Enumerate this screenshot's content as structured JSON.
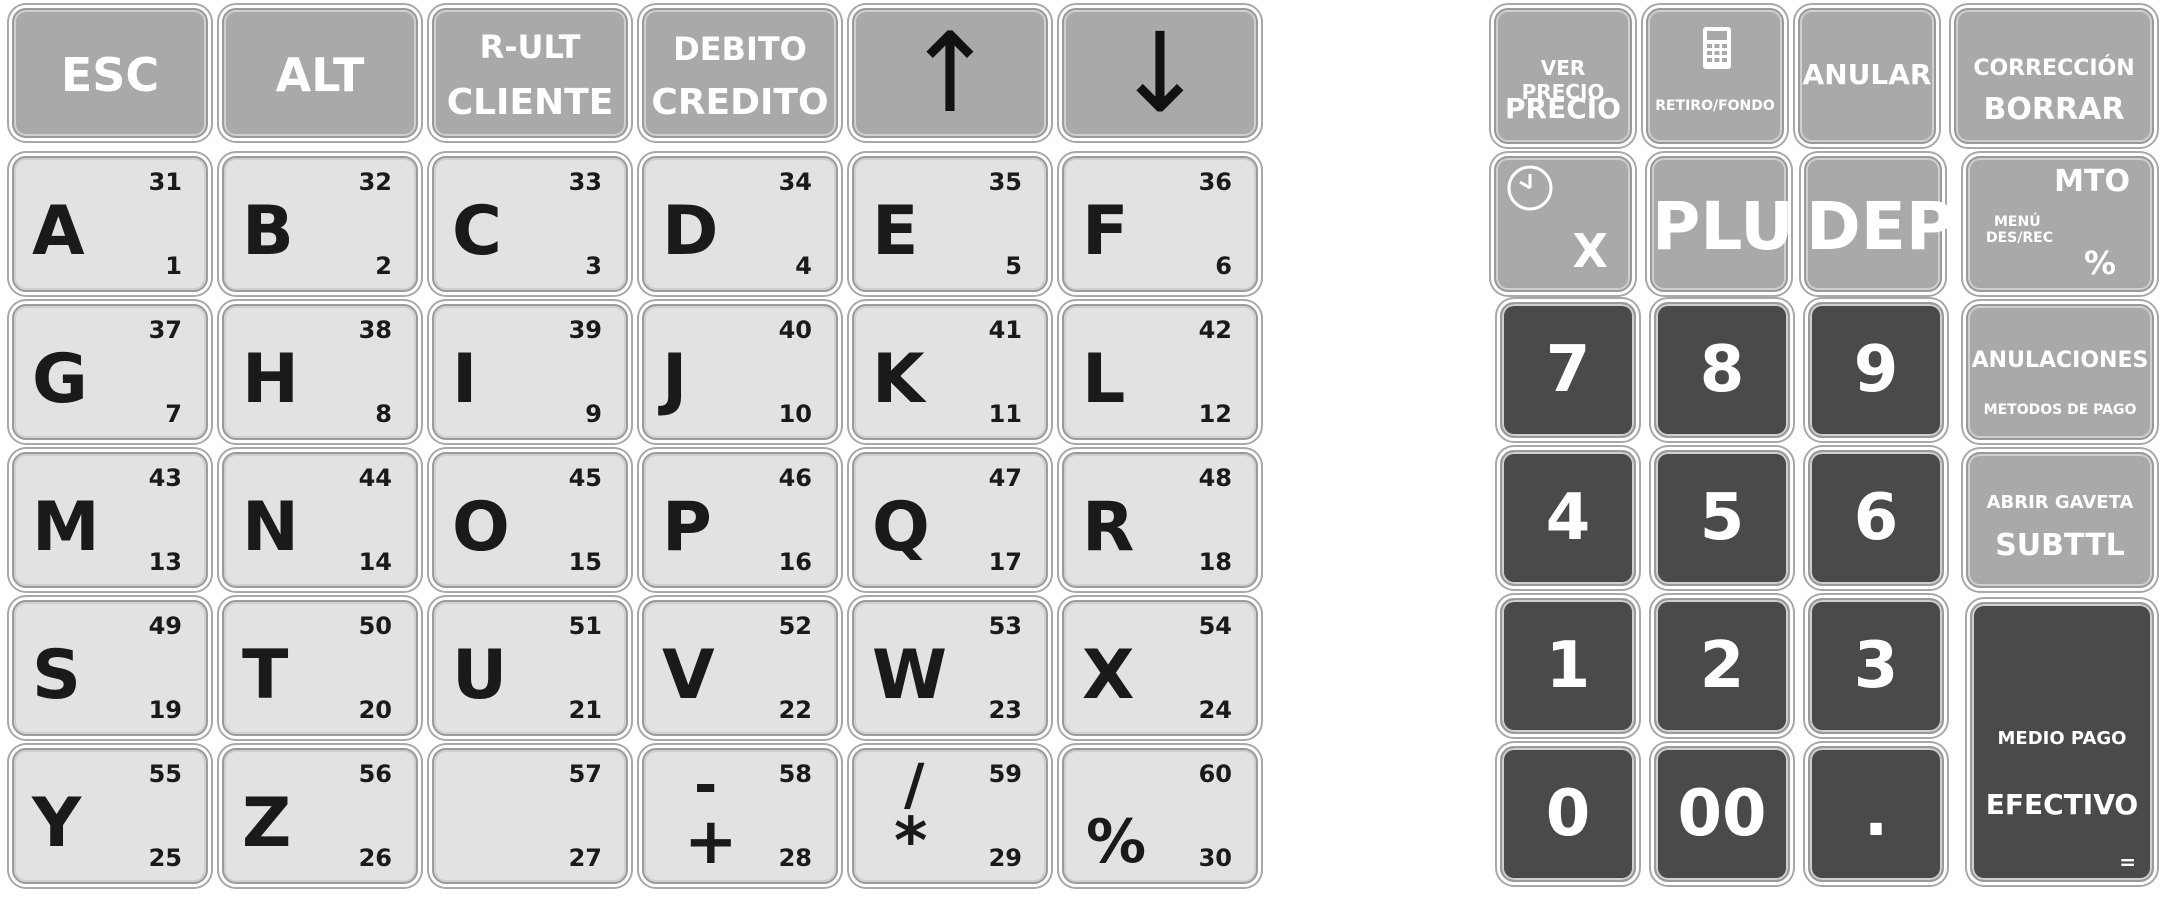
{
  "top_row": [
    {
      "id": "esc",
      "label": "ESC"
    },
    {
      "id": "alt",
      "label": "ALT"
    },
    {
      "id": "rult",
      "line1": "R-ULT",
      "line2": "CLIENTE"
    },
    {
      "id": "debito",
      "line1": "DEBITO",
      "line2": "CREDITO"
    },
    {
      "id": "up",
      "arrow": "↑"
    },
    {
      "id": "down",
      "arrow": "↓"
    }
  ],
  "alpha_keys": [
    {
      "l": "A",
      "t": "31",
      "b": "1"
    },
    {
      "l": "B",
      "t": "32",
      "b": "2"
    },
    {
      "l": "C",
      "t": "33",
      "b": "3"
    },
    {
      "l": "D",
      "t": "34",
      "b": "4"
    },
    {
      "l": "E",
      "t": "35",
      "b": "5"
    },
    {
      "l": "F",
      "t": "36",
      "b": "6"
    },
    {
      "l": "G",
      "t": "37",
      "b": "7"
    },
    {
      "l": "H",
      "t": "38",
      "b": "8"
    },
    {
      "l": "I",
      "t": "39",
      "b": "9"
    },
    {
      "l": "J",
      "t": "40",
      "b": "10"
    },
    {
      "l": "K",
      "t": "41",
      "b": "11"
    },
    {
      "l": "L",
      "t": "42",
      "b": "12"
    },
    {
      "l": "M",
      "t": "43",
      "b": "13"
    },
    {
      "l": "N",
      "t": "44",
      "b": "14"
    },
    {
      "l": "O",
      "t": "45",
      "b": "15"
    },
    {
      "l": "P",
      "t": "46",
      "b": "16"
    },
    {
      "l": "Q",
      "t": "47",
      "b": "17"
    },
    {
      "l": "R",
      "t": "48",
      "b": "18"
    },
    {
      "l": "S",
      "t": "49",
      "b": "19"
    },
    {
      "l": "T",
      "t": "50",
      "b": "20"
    },
    {
      "l": "U",
      "t": "51",
      "b": "21"
    },
    {
      "l": "V",
      "t": "52",
      "b": "22"
    },
    {
      "l": "W",
      "t": "53",
      "b": "23"
    },
    {
      "l": "X",
      "t": "54",
      "b": "24"
    },
    {
      "l": "Y",
      "t": "55",
      "b": "25"
    },
    {
      "l": "Z",
      "t": "56",
      "b": "26"
    },
    {
      "l": "",
      "t": "57",
      "b": "27"
    },
    {
      "s1": "-",
      "s2": "+",
      "t": "58",
      "b": "28"
    },
    {
      "s1": "/",
      "s2": "*",
      "t": "59",
      "b": "29"
    },
    {
      "l": "%",
      "t": "60",
      "b": "30"
    }
  ],
  "right": {
    "ver_precio": {
      "small": "VER PRECIO",
      "big": "PRECIO"
    },
    "retiro": {
      "label": "RETIRO/FONDO"
    },
    "anular": {
      "label": "ANULAR"
    },
    "correccion": {
      "small": "CORRECCIÓN",
      "big": "BORRAR"
    },
    "clock_x": {
      "label": "X"
    },
    "plu": {
      "label": "PLU"
    },
    "dep": {
      "label": "DEP"
    },
    "mto": {
      "top": "MTO",
      "menu1": "MENÚ",
      "menu2": "DES/REC",
      "pct": "%"
    },
    "anulaciones": {
      "big": "ANULACIONES",
      "small": "METODOS DE PAGO"
    },
    "abrir": {
      "small": "ABRIR GAVETA",
      "big": "SUBTTL"
    },
    "medio": {
      "small": "MEDIO PAGO",
      "big": "EFECTIVO",
      "eq": "="
    },
    "numpad": [
      "7",
      "8",
      "9",
      "4",
      "5",
      "6",
      "1",
      "2",
      "3",
      "0",
      "00",
      "."
    ]
  },
  "colors": {
    "alpha": "#e2e2e2",
    "func": "#a9a9a9",
    "dark": "#4a4a4a"
  }
}
